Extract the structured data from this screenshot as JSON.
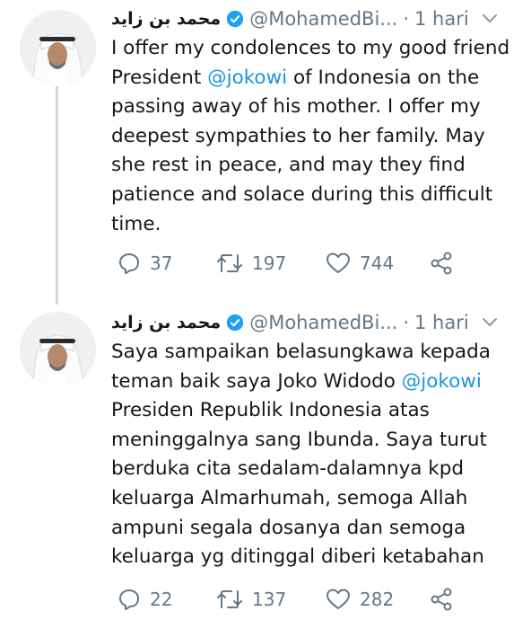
{
  "tweets": [
    {
      "author_name": "محمد بن زايد",
      "handle": "@MohamedBi...",
      "dot": "·",
      "time": "1 hari",
      "text_lines": [
        [
          "I offer my condolences to my good friend",
          null
        ],
        [
          "President ",
          "@jokowi",
          " of Indonesia on the"
        ],
        [
          "passing away of his mother. I offer my",
          null
        ],
        [
          "deepest sympathies to her family. May",
          null
        ],
        [
          "she rest in peace, and may they find",
          null
        ],
        [
          "patience and solace during this difficult",
          null
        ],
        [
          "time.",
          null
        ]
      ],
      "replies": "37",
      "retweets": "197",
      "likes": "744"
    },
    {
      "author_name": "محمد بن زايد",
      "handle": "@MohamedBi...",
      "dot": "·",
      "time": "1 hari",
      "text_lines": [
        [
          "Saya sampaikan belasungkawa kepada",
          null
        ],
        [
          "teman baik saya Joko Widodo ",
          "@jokowi",
          ""
        ],
        [
          "Presiden Republik Indonesia atas",
          null
        ],
        [
          "meninggalnya sang Ibunda. Saya turut",
          null
        ],
        [
          "berduka cita sedalam-dalamnya kpd",
          null
        ],
        [
          "keluarga Almarhumah, semoga Allah",
          null
        ],
        [
          "ampuni segala dosanya dan semoga",
          null
        ],
        [
          "keluarga yg ditinggal diberi ketabahan",
          null
        ]
      ],
      "replies": "22",
      "retweets": "137",
      "likes": "282"
    }
  ],
  "icons": {
    "verified": "verified-badge-icon",
    "caret": "chevron-down-icon",
    "reply": "reply-icon",
    "retweet": "retweet-icon",
    "like": "heart-icon",
    "share": "share-icon"
  },
  "colors": {
    "text": "#14171a",
    "secondary": "#657786",
    "link": "#1b95e0",
    "verified": "#1da1f2",
    "thread_line": "#cfd9de"
  }
}
